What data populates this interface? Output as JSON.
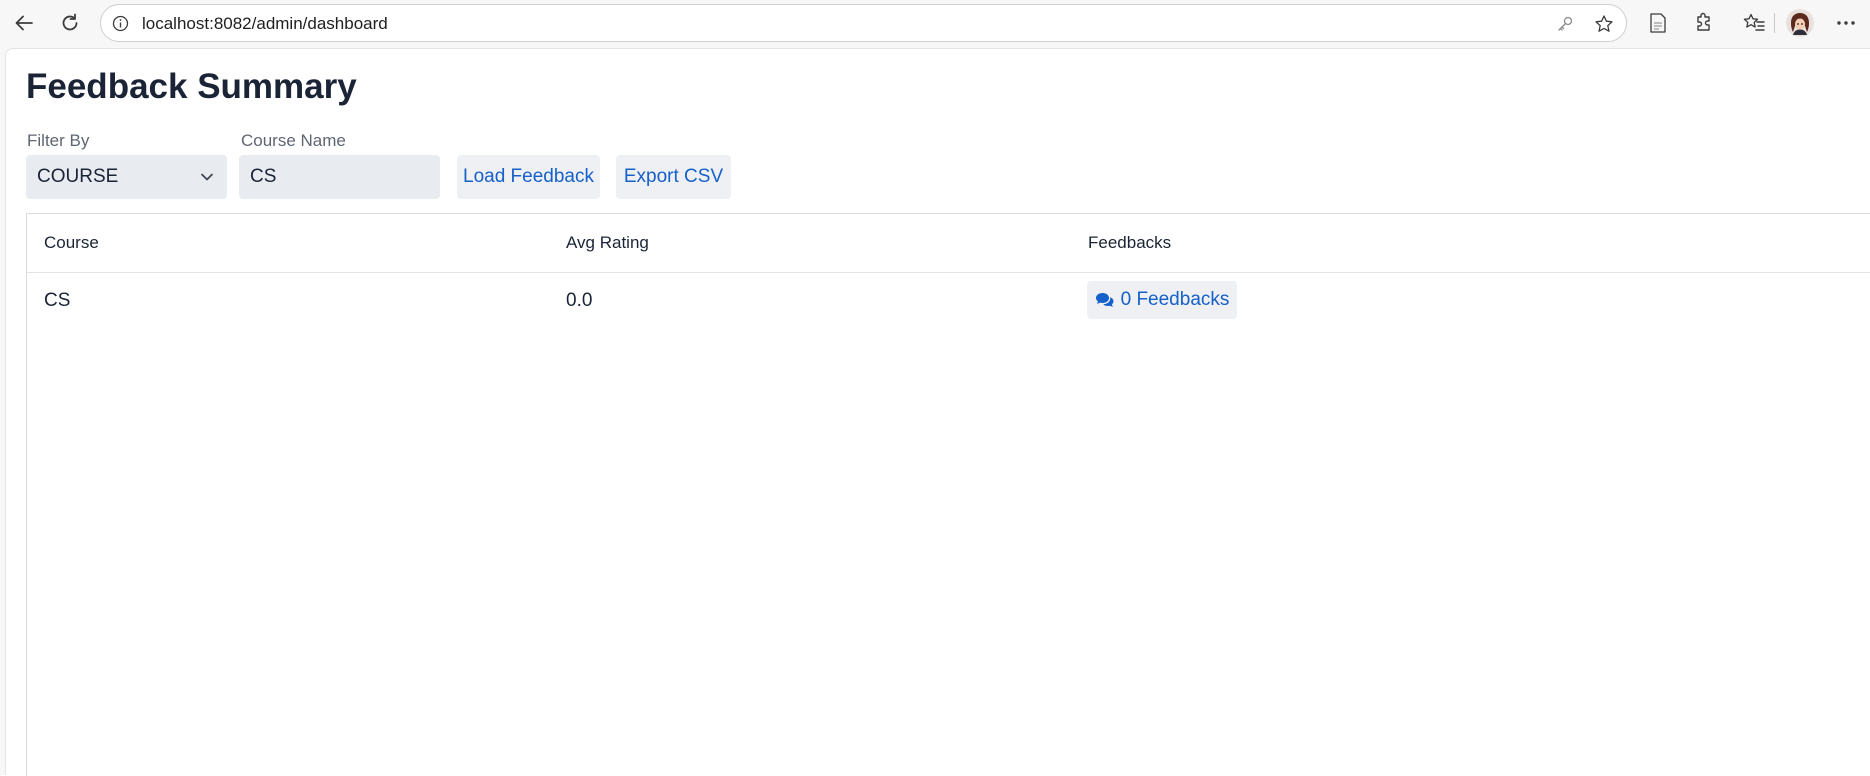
{
  "browser": {
    "url": "localhost:8082/admin/dashboard"
  },
  "page": {
    "title": "Feedback Summary"
  },
  "filters": {
    "filter_by_label": "Filter By",
    "filter_by_value": "COURSE",
    "course_name_label": "Course Name",
    "course_name_value": "CS",
    "load_button": "Load Feedback",
    "export_button": "Export CSV"
  },
  "table": {
    "headers": [
      "Course",
      "Avg Rating",
      "Feedbacks"
    ],
    "rows": [
      {
        "course": "CS",
        "avg_rating": "0.0",
        "feedbacks": "0 Feedbacks"
      }
    ]
  },
  "icons": {
    "back": "back-arrow-icon",
    "refresh": "refresh-icon",
    "info": "info-icon",
    "key": "key-icon",
    "favorite": "star-icon",
    "reading_view": "reading-view-icon",
    "extensions": "puzzle-piece-icon",
    "favorites": "favorites-icon",
    "more": "more-icon",
    "dropdown": "chevron-down-icon",
    "feedbacks": "comments-icon"
  },
  "colors": {
    "accent": "#1560c9",
    "heading": "#1b2436",
    "input_bg": "#e8ebef",
    "button_bg": "#eef0f3"
  }
}
